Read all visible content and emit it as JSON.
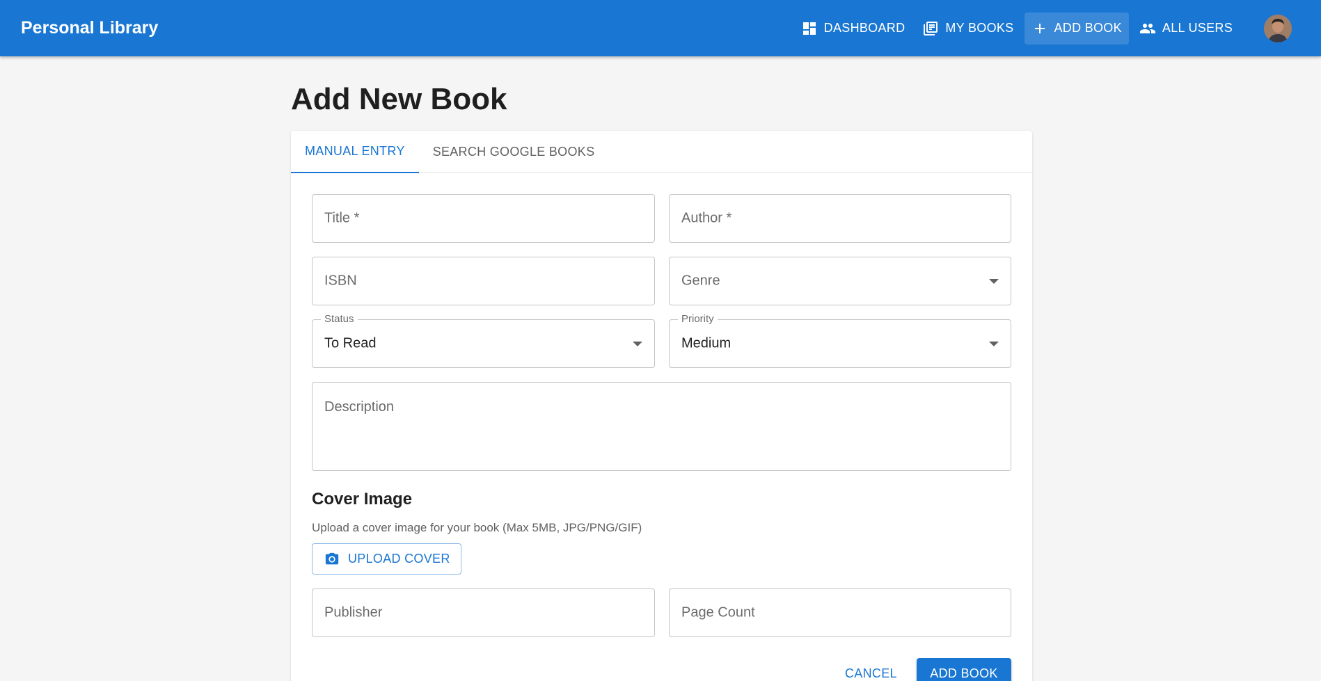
{
  "app": {
    "title": "Personal Library"
  },
  "nav": {
    "items": [
      {
        "label": "DASHBOARD",
        "icon": "dashboard-icon"
      },
      {
        "label": "MY BOOKS",
        "icon": "library-books-icon"
      },
      {
        "label": "ADD BOOK",
        "icon": "plus-icon",
        "active": true
      },
      {
        "label": "ALL USERS",
        "icon": "people-icon"
      }
    ]
  },
  "page": {
    "title": "Add New Book"
  },
  "tabs": [
    {
      "label": "MANUAL ENTRY",
      "active": true
    },
    {
      "label": "SEARCH GOOGLE BOOKS"
    }
  ],
  "form": {
    "title_placeholder": "Title *",
    "author_placeholder": "Author *",
    "isbn_placeholder": "ISBN",
    "genre_placeholder": "Genre",
    "status_label": "Status",
    "status_value": "To Read",
    "priority_label": "Priority",
    "priority_value": "Medium",
    "description_placeholder": "Description",
    "cover_title": "Cover Image",
    "cover_subtitle": "Upload a cover image for your book (Max 5MB, JPG/PNG/GIF)",
    "upload_label": "UPLOAD COVER",
    "publisher_placeholder": "Publisher",
    "page_count_placeholder": "Page Count",
    "cancel_label": "CANCEL",
    "submit_label": "ADD BOOK"
  },
  "colors": {
    "primary": "#1976d2",
    "background": "#f5f5f5"
  }
}
